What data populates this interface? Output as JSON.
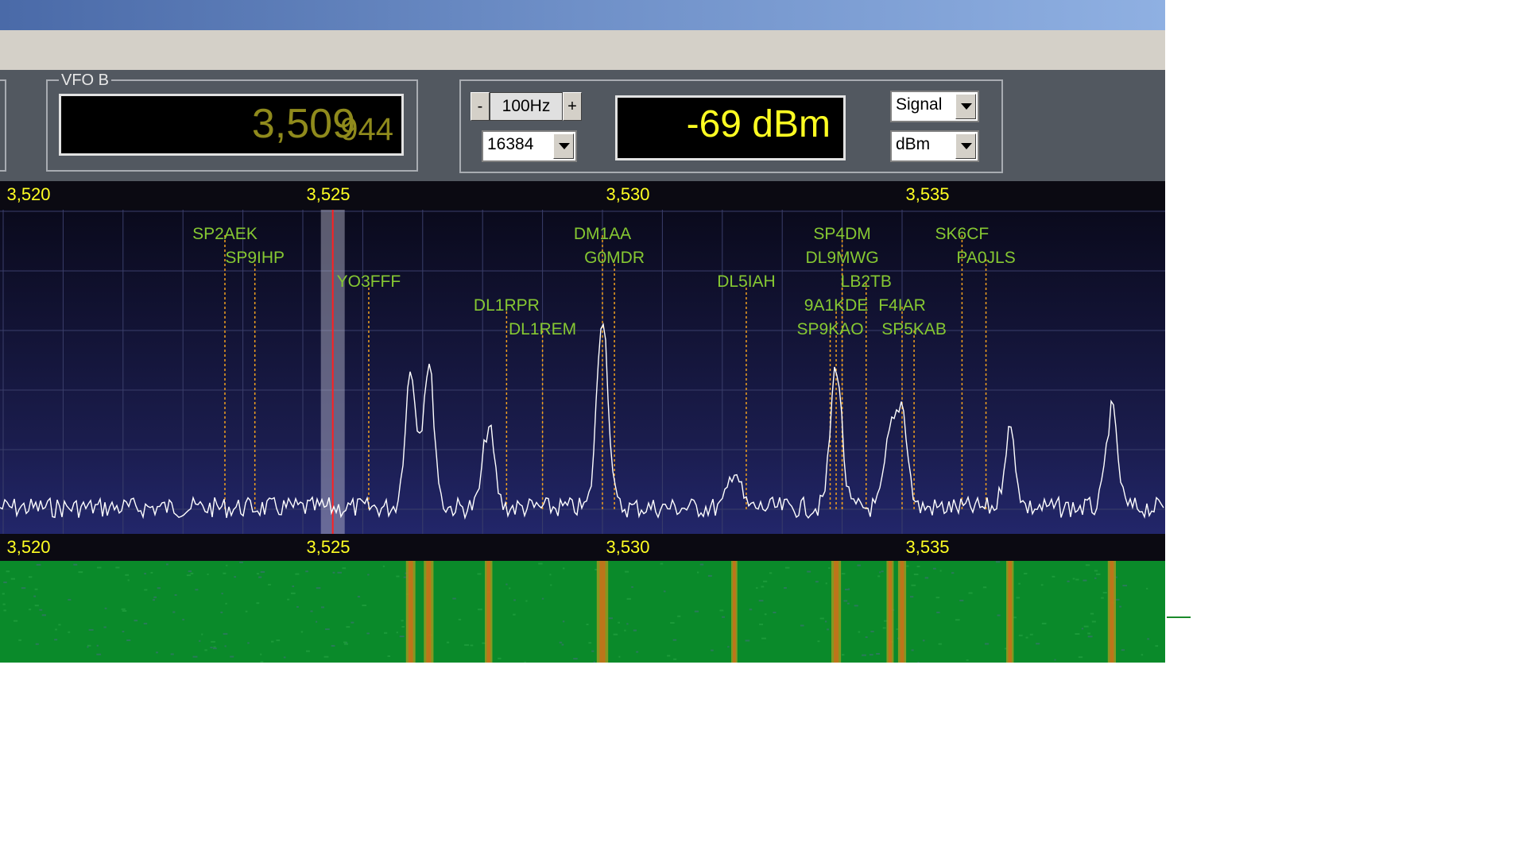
{
  "vfo_b": {
    "label": "VFO B",
    "freq_main": "3,509",
    "freq_sub": "944"
  },
  "step": {
    "minus": "-",
    "value": "100Hz",
    "plus": "+"
  },
  "fft_size": {
    "value": "16384"
  },
  "signal": {
    "value": "-69 dBm"
  },
  "mode_select": {
    "value": "Signal"
  },
  "unit_select": {
    "value": "dBm"
  },
  "scale_labels": [
    "3,520",
    "3,525",
    "3,530",
    "3,535"
  ],
  "scale_mhz": [
    3.52,
    3.525,
    3.53,
    3.535
  ],
  "spots": [
    {
      "call": "SP2AEK",
      "freq": 3.5237
    },
    {
      "call": "SP9IHP",
      "freq": 3.5242
    },
    {
      "call": "YO3FFF",
      "freq": 3.5261
    },
    {
      "call": "DL1RPR",
      "freq": 3.5284
    },
    {
      "call": "DL1REM",
      "freq": 3.529
    },
    {
      "call": "DM1AA",
      "freq": 3.53
    },
    {
      "call": "G0MDR",
      "freq": 3.5302
    },
    {
      "call": "DL5IAH",
      "freq": 3.5324
    },
    {
      "call": "SP4DM",
      "freq": 3.534
    },
    {
      "call": "DL9MWG",
      "freq": 3.534
    },
    {
      "call": "LB2TB",
      "freq": 3.5344
    },
    {
      "call": "9A1KDE",
      "freq": 3.5339
    },
    {
      "call": "F4IAR",
      "freq": 3.535
    },
    {
      "call": "SP9KAO",
      "freq": 3.5338
    },
    {
      "call": "SP5KAB",
      "freq": 3.5352
    },
    {
      "call": "SK6CF",
      "freq": 3.536
    },
    {
      "call": "PA0JLS",
      "freq": 3.5364
    }
  ],
  "peaks": [
    {
      "freq": 3.5268,
      "level": 0.42
    },
    {
      "freq": 3.5271,
      "level": 0.44
    },
    {
      "freq": 3.5281,
      "level": 0.25
    },
    {
      "freq": 3.53,
      "level": 0.6
    },
    {
      "freq": 3.5322,
      "level": 0.12
    },
    {
      "freq": 3.5339,
      "level": 0.44
    },
    {
      "freq": 3.5348,
      "level": 0.21
    },
    {
      "freq": 3.535,
      "level": 0.3
    },
    {
      "freq": 3.5368,
      "level": 0.24
    },
    {
      "freq": 3.5385,
      "level": 0.3
    }
  ],
  "rx_marker_freq": 3.5255,
  "colors": {
    "scale": "#ffff22",
    "spot": "#86c832",
    "spot_line": "#f0a020",
    "trace": "#ffffff",
    "rx": "#ff2020"
  }
}
